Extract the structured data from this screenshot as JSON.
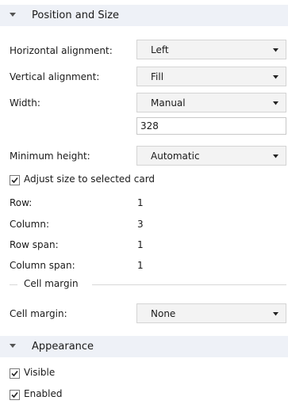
{
  "position_section": {
    "title": "Position and Size",
    "horizontal_alignment": {
      "label": "Horizontal alignment:",
      "value": "Left"
    },
    "vertical_alignment": {
      "label": "Vertical alignment:",
      "value": "Fill"
    },
    "width": {
      "label": "Width:",
      "value": "Manual",
      "input_value": "328"
    },
    "minimum_height": {
      "label": "Minimum height:",
      "value": "Automatic"
    },
    "adjust_size": {
      "label": "Adjust size to selected card",
      "checked": true
    },
    "row": {
      "label": "Row:",
      "value": "1"
    },
    "column": {
      "label": "Column:",
      "value": "3"
    },
    "row_span": {
      "label": "Row span:",
      "value": "1"
    },
    "column_span": {
      "label": "Column span:",
      "value": "1"
    },
    "cell_margin_group": {
      "title": "Cell margin"
    },
    "cell_margin": {
      "label": "Cell margin:",
      "value": "None"
    }
  },
  "appearance_section": {
    "title": "Appearance",
    "visible": {
      "label": "Visible",
      "checked": true
    },
    "enabled": {
      "label": "Enabled",
      "checked": true
    }
  }
}
